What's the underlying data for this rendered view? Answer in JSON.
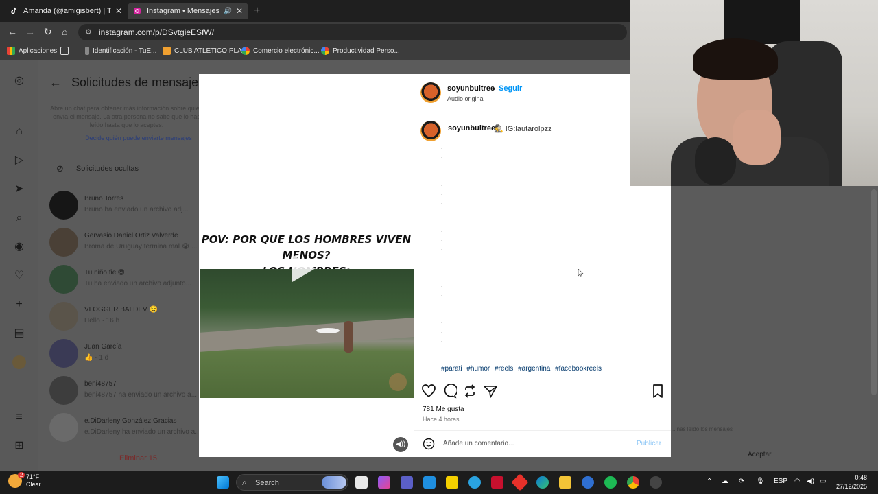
{
  "browser": {
    "tabs": [
      {
        "title": "Amanda (@amigisbert) | TikTok",
        "active": false
      },
      {
        "title": "Instagram • Mensajes",
        "active": true
      }
    ],
    "url": "instagram.com/p/DSvtgieESfW/",
    "bookmarks": [
      {
        "label": "Aplicaciones"
      },
      {
        "label": "Identificación - TuE..."
      },
      {
        "label": "CLUB ATLETICO PLA..."
      },
      {
        "label": "Comercio electrónic..."
      },
      {
        "label": "Productividad Perso..."
      }
    ]
  },
  "sidebar": {
    "icons": [
      "instagram-icon",
      "home-icon",
      "reels-icon",
      "send-icon",
      "search-icon",
      "explore-icon",
      "heart-icon",
      "create-icon",
      "dashboard-icon",
      "profile-icon",
      "menu-icon",
      "apps-icon"
    ]
  },
  "requests_panel": {
    "title": "Solicitudes de mensaje",
    "description": "Abre un chat para obtener más información sobre quién envía el mensaje. La otra persona no sabe que lo has leído hasta que lo aceptes.",
    "link": "Decide quién puede enviarte mensajes",
    "hidden_requests": "Solicitudes ocultas",
    "chats": [
      {
        "name": "Bruno Torres",
        "preview": "Bruno ha enviado un archivo adj..."
      },
      {
        "name": "Gervasio Daniel Ortiz Valverde",
        "preview": "Broma de Uruguay termina mal 😭 ..."
      },
      {
        "name": "Tu niño fiel😍",
        "preview": "Tu ha enviado un archivo adjunto..."
      },
      {
        "name": "VLOGGER BALDEV 🤤",
        "preview": "Hello · 16 h"
      },
      {
        "name": "Juan García",
        "preview": "👍 · 1 d"
      },
      {
        "name": "beni48757",
        "preview": "beni48757 ha enviado un archivo a..."
      },
      {
        "name": "e.DiDarleny González Gracias",
        "preview": "e.DiDarleny ha enviado un archivo a..."
      }
    ],
    "delete_label": "Eliminar 15",
    "read_note": "...nas leído los mensajes",
    "accept_label": "Aceptar"
  },
  "post": {
    "overlay_line1": "POV: POR QUE LOS HOMBRES VIVEN MENOS?",
    "overlay_line2": "LOS HOMBRES:",
    "author": "soyunbuitree",
    "follow_label": "Seguir",
    "separator": "•",
    "audio": "Audio original",
    "caption_user": "soyunbuitree",
    "caption_text": "🕵️ IG:lautarolpzz",
    "dot_lines": [
      ".",
      ".",
      ".",
      ".",
      ".",
      ".",
      ".",
      ".",
      ".",
      ".",
      ".",
      ".",
      ".",
      ".",
      ".",
      ".",
      ".",
      ".",
      ".",
      ".",
      ".",
      ".",
      "."
    ],
    "hashtags": [
      "#parati",
      "#humor",
      "#reels",
      "#argentina",
      "#facebookreels"
    ],
    "likes": "781 Me gusta",
    "time_ago": "Hace 4 horas",
    "comment_placeholder": "Añade un comentario...",
    "publish_label": "Publicar"
  },
  "taskbar": {
    "temperature": "71°F",
    "condition": "Clear",
    "weather_badge": "2",
    "search_label": "Search",
    "language": "ESP",
    "time": "0:48",
    "date": "27/12/2025"
  },
  "colors": {
    "ig_blue": "#0095f6",
    "hashtag": "#00376b",
    "overlay_dim": "#5b5b5b",
    "taskbar": "#1c1c1c"
  }
}
